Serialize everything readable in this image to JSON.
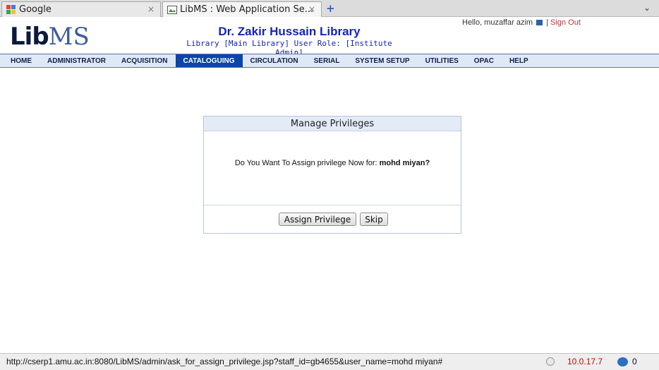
{
  "browser": {
    "tabs": [
      {
        "title": "Google",
        "close": "×"
      },
      {
        "title": "LibMS : Web Application Se...",
        "close": "×"
      }
    ],
    "new_tab": "+",
    "tab_menu": "⌄"
  },
  "header": {
    "logo_lib": "Lib",
    "logo_ms": "MS",
    "library_name": "Dr. Zakir Hussain Library",
    "library_info": "Library [Main Library]  User Role: [Institute Admin]",
    "greeting": "Hello,  muzaffar azim",
    "separator": "|",
    "sign_out": "Sign Out"
  },
  "menu": [
    {
      "label": "HOME",
      "active": false
    },
    {
      "label": "ADMINISTRATOR",
      "active": false
    },
    {
      "label": "ACQUISITION",
      "active": false
    },
    {
      "label": "CATALOGUING",
      "active": true
    },
    {
      "label": "CIRCULATION",
      "active": false
    },
    {
      "label": "SERIAL",
      "active": false
    },
    {
      "label": "SYSTEM SETUP",
      "active": false
    },
    {
      "label": "UTILITIES",
      "active": false
    },
    {
      "label": "OPAC",
      "active": false
    },
    {
      "label": "HELP",
      "active": false
    }
  ],
  "dialog": {
    "title": "Manage Privileges",
    "message": "Do You Want To Assign privilege Now for: ",
    "user_name": "mohd miyan?",
    "assign_label": "Assign Privilege",
    "skip_label": "Skip"
  },
  "status": {
    "url": "http://cserp1.amu.ac.in:8080/LibMS/admin/ask_for_assign_privilege.jsp?staff_id=gb4655&user_name=mohd miyan#",
    "ip": "10.0.17.7",
    "count": "0"
  },
  "colors": {
    "menu_bg": "#dfe8f5",
    "menu_active": "#0a46a8",
    "title_blue": "#1424b8",
    "sign_out_red": "#c03030"
  }
}
